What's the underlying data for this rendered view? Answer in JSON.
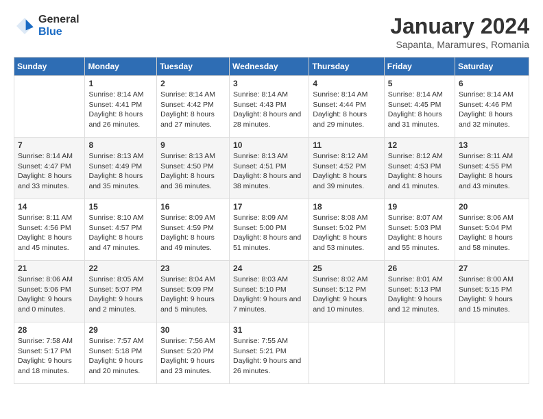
{
  "logo": {
    "general": "General",
    "blue": "Blue"
  },
  "title": "January 2024",
  "subtitle": "Sapanta, Maramures, Romania",
  "days_header": [
    "Sunday",
    "Monday",
    "Tuesday",
    "Wednesday",
    "Thursday",
    "Friday",
    "Saturday"
  ],
  "weeks": [
    [
      {
        "day": "",
        "sunrise": "",
        "sunset": "",
        "daylight": ""
      },
      {
        "day": "1",
        "sunrise": "Sunrise: 8:14 AM",
        "sunset": "Sunset: 4:41 PM",
        "daylight": "Daylight: 8 hours and 26 minutes."
      },
      {
        "day": "2",
        "sunrise": "Sunrise: 8:14 AM",
        "sunset": "Sunset: 4:42 PM",
        "daylight": "Daylight: 8 hours and 27 minutes."
      },
      {
        "day": "3",
        "sunrise": "Sunrise: 8:14 AM",
        "sunset": "Sunset: 4:43 PM",
        "daylight": "Daylight: 8 hours and 28 minutes."
      },
      {
        "day": "4",
        "sunrise": "Sunrise: 8:14 AM",
        "sunset": "Sunset: 4:44 PM",
        "daylight": "Daylight: 8 hours and 29 minutes."
      },
      {
        "day": "5",
        "sunrise": "Sunrise: 8:14 AM",
        "sunset": "Sunset: 4:45 PM",
        "daylight": "Daylight: 8 hours and 31 minutes."
      },
      {
        "day": "6",
        "sunrise": "Sunrise: 8:14 AM",
        "sunset": "Sunset: 4:46 PM",
        "daylight": "Daylight: 8 hours and 32 minutes."
      }
    ],
    [
      {
        "day": "7",
        "sunrise": "Sunrise: 8:14 AM",
        "sunset": "Sunset: 4:47 PM",
        "daylight": "Daylight: 8 hours and 33 minutes."
      },
      {
        "day": "8",
        "sunrise": "Sunrise: 8:13 AM",
        "sunset": "Sunset: 4:49 PM",
        "daylight": "Daylight: 8 hours and 35 minutes."
      },
      {
        "day": "9",
        "sunrise": "Sunrise: 8:13 AM",
        "sunset": "Sunset: 4:50 PM",
        "daylight": "Daylight: 8 hours and 36 minutes."
      },
      {
        "day": "10",
        "sunrise": "Sunrise: 8:13 AM",
        "sunset": "Sunset: 4:51 PM",
        "daylight": "Daylight: 8 hours and 38 minutes."
      },
      {
        "day": "11",
        "sunrise": "Sunrise: 8:12 AM",
        "sunset": "Sunset: 4:52 PM",
        "daylight": "Daylight: 8 hours and 39 minutes."
      },
      {
        "day": "12",
        "sunrise": "Sunrise: 8:12 AM",
        "sunset": "Sunset: 4:53 PM",
        "daylight": "Daylight: 8 hours and 41 minutes."
      },
      {
        "day": "13",
        "sunrise": "Sunrise: 8:11 AM",
        "sunset": "Sunset: 4:55 PM",
        "daylight": "Daylight: 8 hours and 43 minutes."
      }
    ],
    [
      {
        "day": "14",
        "sunrise": "Sunrise: 8:11 AM",
        "sunset": "Sunset: 4:56 PM",
        "daylight": "Daylight: 8 hours and 45 minutes."
      },
      {
        "day": "15",
        "sunrise": "Sunrise: 8:10 AM",
        "sunset": "Sunset: 4:57 PM",
        "daylight": "Daylight: 8 hours and 47 minutes."
      },
      {
        "day": "16",
        "sunrise": "Sunrise: 8:09 AM",
        "sunset": "Sunset: 4:59 PM",
        "daylight": "Daylight: 8 hours and 49 minutes."
      },
      {
        "day": "17",
        "sunrise": "Sunrise: 8:09 AM",
        "sunset": "Sunset: 5:00 PM",
        "daylight": "Daylight: 8 hours and 51 minutes."
      },
      {
        "day": "18",
        "sunrise": "Sunrise: 8:08 AM",
        "sunset": "Sunset: 5:02 PM",
        "daylight": "Daylight: 8 hours and 53 minutes."
      },
      {
        "day": "19",
        "sunrise": "Sunrise: 8:07 AM",
        "sunset": "Sunset: 5:03 PM",
        "daylight": "Daylight: 8 hours and 55 minutes."
      },
      {
        "day": "20",
        "sunrise": "Sunrise: 8:06 AM",
        "sunset": "Sunset: 5:04 PM",
        "daylight": "Daylight: 8 hours and 58 minutes."
      }
    ],
    [
      {
        "day": "21",
        "sunrise": "Sunrise: 8:06 AM",
        "sunset": "Sunset: 5:06 PM",
        "daylight": "Daylight: 9 hours and 0 minutes."
      },
      {
        "day": "22",
        "sunrise": "Sunrise: 8:05 AM",
        "sunset": "Sunset: 5:07 PM",
        "daylight": "Daylight: 9 hours and 2 minutes."
      },
      {
        "day": "23",
        "sunrise": "Sunrise: 8:04 AM",
        "sunset": "Sunset: 5:09 PM",
        "daylight": "Daylight: 9 hours and 5 minutes."
      },
      {
        "day": "24",
        "sunrise": "Sunrise: 8:03 AM",
        "sunset": "Sunset: 5:10 PM",
        "daylight": "Daylight: 9 hours and 7 minutes."
      },
      {
        "day": "25",
        "sunrise": "Sunrise: 8:02 AM",
        "sunset": "Sunset: 5:12 PM",
        "daylight": "Daylight: 9 hours and 10 minutes."
      },
      {
        "day": "26",
        "sunrise": "Sunrise: 8:01 AM",
        "sunset": "Sunset: 5:13 PM",
        "daylight": "Daylight: 9 hours and 12 minutes."
      },
      {
        "day": "27",
        "sunrise": "Sunrise: 8:00 AM",
        "sunset": "Sunset: 5:15 PM",
        "daylight": "Daylight: 9 hours and 15 minutes."
      }
    ],
    [
      {
        "day": "28",
        "sunrise": "Sunrise: 7:58 AM",
        "sunset": "Sunset: 5:17 PM",
        "daylight": "Daylight: 9 hours and 18 minutes."
      },
      {
        "day": "29",
        "sunrise": "Sunrise: 7:57 AM",
        "sunset": "Sunset: 5:18 PM",
        "daylight": "Daylight: 9 hours and 20 minutes."
      },
      {
        "day": "30",
        "sunrise": "Sunrise: 7:56 AM",
        "sunset": "Sunset: 5:20 PM",
        "daylight": "Daylight: 9 hours and 23 minutes."
      },
      {
        "day": "31",
        "sunrise": "Sunrise: 7:55 AM",
        "sunset": "Sunset: 5:21 PM",
        "daylight": "Daylight: 9 hours and 26 minutes."
      },
      {
        "day": "",
        "sunrise": "",
        "sunset": "",
        "daylight": ""
      },
      {
        "day": "",
        "sunrise": "",
        "sunset": "",
        "daylight": ""
      },
      {
        "day": "",
        "sunrise": "",
        "sunset": "",
        "daylight": ""
      }
    ]
  ]
}
